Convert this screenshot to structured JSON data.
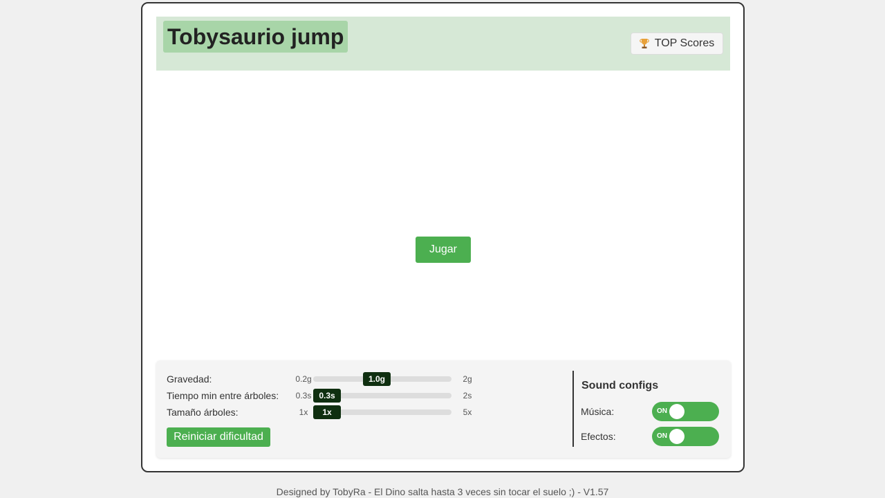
{
  "header": {
    "title": "Tobysaurio jump",
    "top_scores_label": "TOP Scores",
    "top_scores_icon": "trophy-icon"
  },
  "main": {
    "play_label": "Jugar"
  },
  "difficulty": {
    "rows": [
      {
        "label": "Gravedad:",
        "min": "0.2g",
        "max": "2g",
        "value": "1.0g",
        "fraction": 0.45
      },
      {
        "label": "Tiempo min entre árboles:",
        "min": "0.3s",
        "max": "2s",
        "value": "0.3s",
        "fraction": 0.0
      },
      {
        "label": "Tamaño árboles:",
        "min": "1x",
        "max": "5x",
        "value": "1x",
        "fraction": 0.0
      }
    ],
    "reset_label": "Reiniciar dificultad"
  },
  "sound": {
    "title": "Sound configs",
    "music_label": "Música:",
    "music_state": "ON",
    "effects_label": "Efectos:",
    "effects_state": "ON"
  },
  "footer": {
    "text": "Designed by TobyRa - El Dino salta hasta 3 veces sin tocar el suelo ;) - V1.57"
  },
  "colors": {
    "accent": "#4caf50",
    "header_bg": "#d6e8d6",
    "title_bg": "#a8d5a8",
    "slider_thumb": "#0f2f10"
  }
}
